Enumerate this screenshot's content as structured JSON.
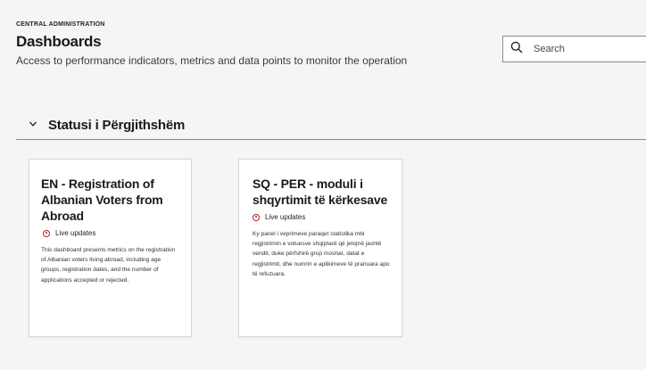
{
  "header": {
    "eyebrow": "CENTRAL ADMINISTRATION",
    "title": "Dashboards",
    "subtitle": "Access to performance indicators, metrics and data points to monitor the operation"
  },
  "search": {
    "placeholder": "Search",
    "icon": "search-icon"
  },
  "section": {
    "title": "Statusi i Përgjithshëm",
    "icon": "chevron-down-icon",
    "expanded": true
  },
  "cards": [
    {
      "title": "EN - Registration of Albanian Voters from Abroad",
      "live_label": "Live updates",
      "description": "This dashboard presents metrics on the registration of Albanian voters living abroad, including age groups, registration dates, and the number of applications accepted or rejected."
    },
    {
      "title": "SQ - PER - moduli i shqyrtimit të kërkesave",
      "live_label": "Live updates",
      "description": "Ky panel i veprimeve paraqet statistika mbi regjistrimin e votuesve shqiptarë që jetojnë jashtë vendit, duke përfshirë grup moshat, datat e regjistrimit, dhe numrin e aplikimeve të pranuara apo të refuzuara."
    }
  ],
  "colors": {
    "live_indicator": "#b3202a",
    "background": "#f5f5f5",
    "card_bg": "#ffffff"
  }
}
